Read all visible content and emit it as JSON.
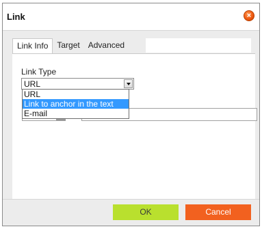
{
  "dialog": {
    "title": "Link"
  },
  "tabs": [
    {
      "label": "Link Info",
      "active": true
    },
    {
      "label": "Target",
      "active": false
    },
    {
      "label": "Advanced",
      "active": false
    }
  ],
  "link_type": {
    "label": "Link Type",
    "value": "URL",
    "options": [
      "URL",
      "Link to anchor in the text",
      "E-mail"
    ],
    "highlighted": "Link to anchor in the text"
  },
  "footer": {
    "ok_label": "OK",
    "cancel_label": "Cancel"
  },
  "colors": {
    "ok_button": "#b9e02e",
    "cancel_button": "#f2611f",
    "close_button": "#ee5a12",
    "highlight": "#3399ff"
  },
  "icons": {
    "close": "close-icon",
    "dropdown": "chevron-down-icon"
  }
}
